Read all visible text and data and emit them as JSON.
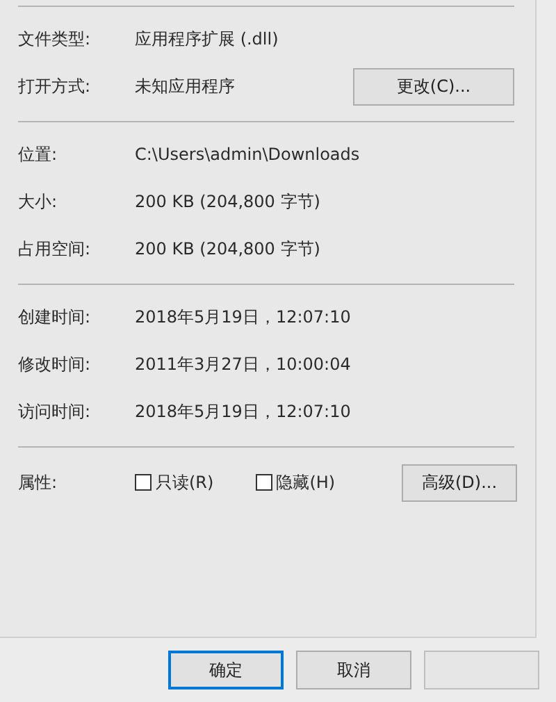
{
  "sections": [
    {
      "rows": [
        {
          "label": "文件类型:",
          "value": "应用程序扩展 (.dll)"
        },
        {
          "label": "打开方式:",
          "value": "未知应用程序",
          "button": "更改(C)..."
        }
      ]
    },
    {
      "rows": [
        {
          "label": "位置:",
          "value": "C:\\Users\\admin\\Downloads"
        },
        {
          "label": "大小:",
          "value": "200 KB (204,800 字节)"
        },
        {
          "label": "占用空间:",
          "value": "200 KB (204,800 字节)"
        }
      ]
    },
    {
      "rows": [
        {
          "label": "创建时间:",
          "value": "2018年5月19日，12:07:10"
        },
        {
          "label": "修改时间:",
          "value": "2011年3月27日，10:00:04"
        },
        {
          "label": "访问时间:",
          "value": "2018年5月19日，12:07:10"
        }
      ]
    }
  ],
  "attributes": {
    "label": "属性:",
    "checkboxes": [
      {
        "label": "只读(R)",
        "checked": false
      },
      {
        "label": "隐藏(H)",
        "checked": false
      }
    ],
    "button": "高级(D)..."
  },
  "buttons": [
    {
      "label": "确定",
      "default": true,
      "disabled": false
    },
    {
      "label": "取消",
      "default": false,
      "disabled": false
    },
    {
      "default": false,
      "disabled": true
    }
  ]
}
